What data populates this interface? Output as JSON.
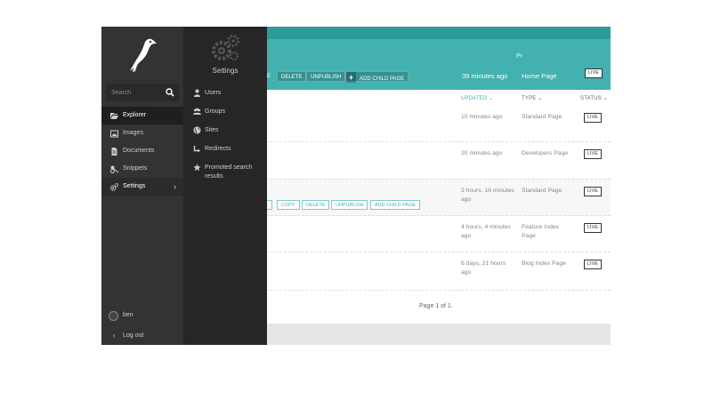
{
  "header": {
    "buttons": [
      "E",
      "DELETE",
      "UNPUBLISH",
      "ADD CHILD PAGE"
    ],
    "updated": "39 minutes ago",
    "type": "Home Page",
    "status": "LIVE",
    "cut_text": "Pr"
  },
  "columns": {
    "updated": "UPDATED",
    "type": "TYPE",
    "status": "STATUS"
  },
  "rows": [
    {
      "updated": "10 minutes ago",
      "type": "Standard Page",
      "status": "LIVE"
    },
    {
      "updated": "20 minutes ago",
      "type": "Developers Page",
      "status": "LIVE"
    },
    {
      "updated": "3 hours, 16 minutes ago",
      "type": "Standard Page",
      "status": "LIVE",
      "actions": [
        "E",
        "COPY",
        "DELETE",
        "UNPUBLISH",
        "ADD CHILD PAGE"
      ]
    },
    {
      "updated": "4 hours, 4 minutes ago",
      "type": "Feature Index Page",
      "status": "LIVE"
    },
    {
      "updated": "6 days, 21 hours ago",
      "type": "Blog Index Page",
      "status": "LIVE"
    }
  ],
  "pagination": "Page 1 of 1.",
  "sidebar": {
    "search_placeholder": "Search",
    "items": [
      {
        "label": "Explorer",
        "icon": "folder-open-icon"
      },
      {
        "label": "Images",
        "icon": "image-icon"
      },
      {
        "label": "Documents",
        "icon": "document-icon"
      },
      {
        "label": "Snippets",
        "icon": "snippet-icon"
      },
      {
        "label": "Settings",
        "icon": "cogs-icon"
      }
    ],
    "user": "ben",
    "logout": "Log out"
  },
  "submenu": {
    "title": "Settings",
    "items": [
      {
        "label": "Users",
        "icon": "user-icon"
      },
      {
        "label": "Groups",
        "icon": "group-icon"
      },
      {
        "label": "Sites",
        "icon": "site-icon"
      },
      {
        "label": "Redirects",
        "icon": "redirect-icon"
      },
      {
        "label": "Promoted search results",
        "icon": "star-icon"
      }
    ]
  },
  "colors": {
    "teal": "#43b1b0",
    "teal_dark": "#2a9d99",
    "sidebar": "#333333",
    "submenu": "#262626"
  }
}
